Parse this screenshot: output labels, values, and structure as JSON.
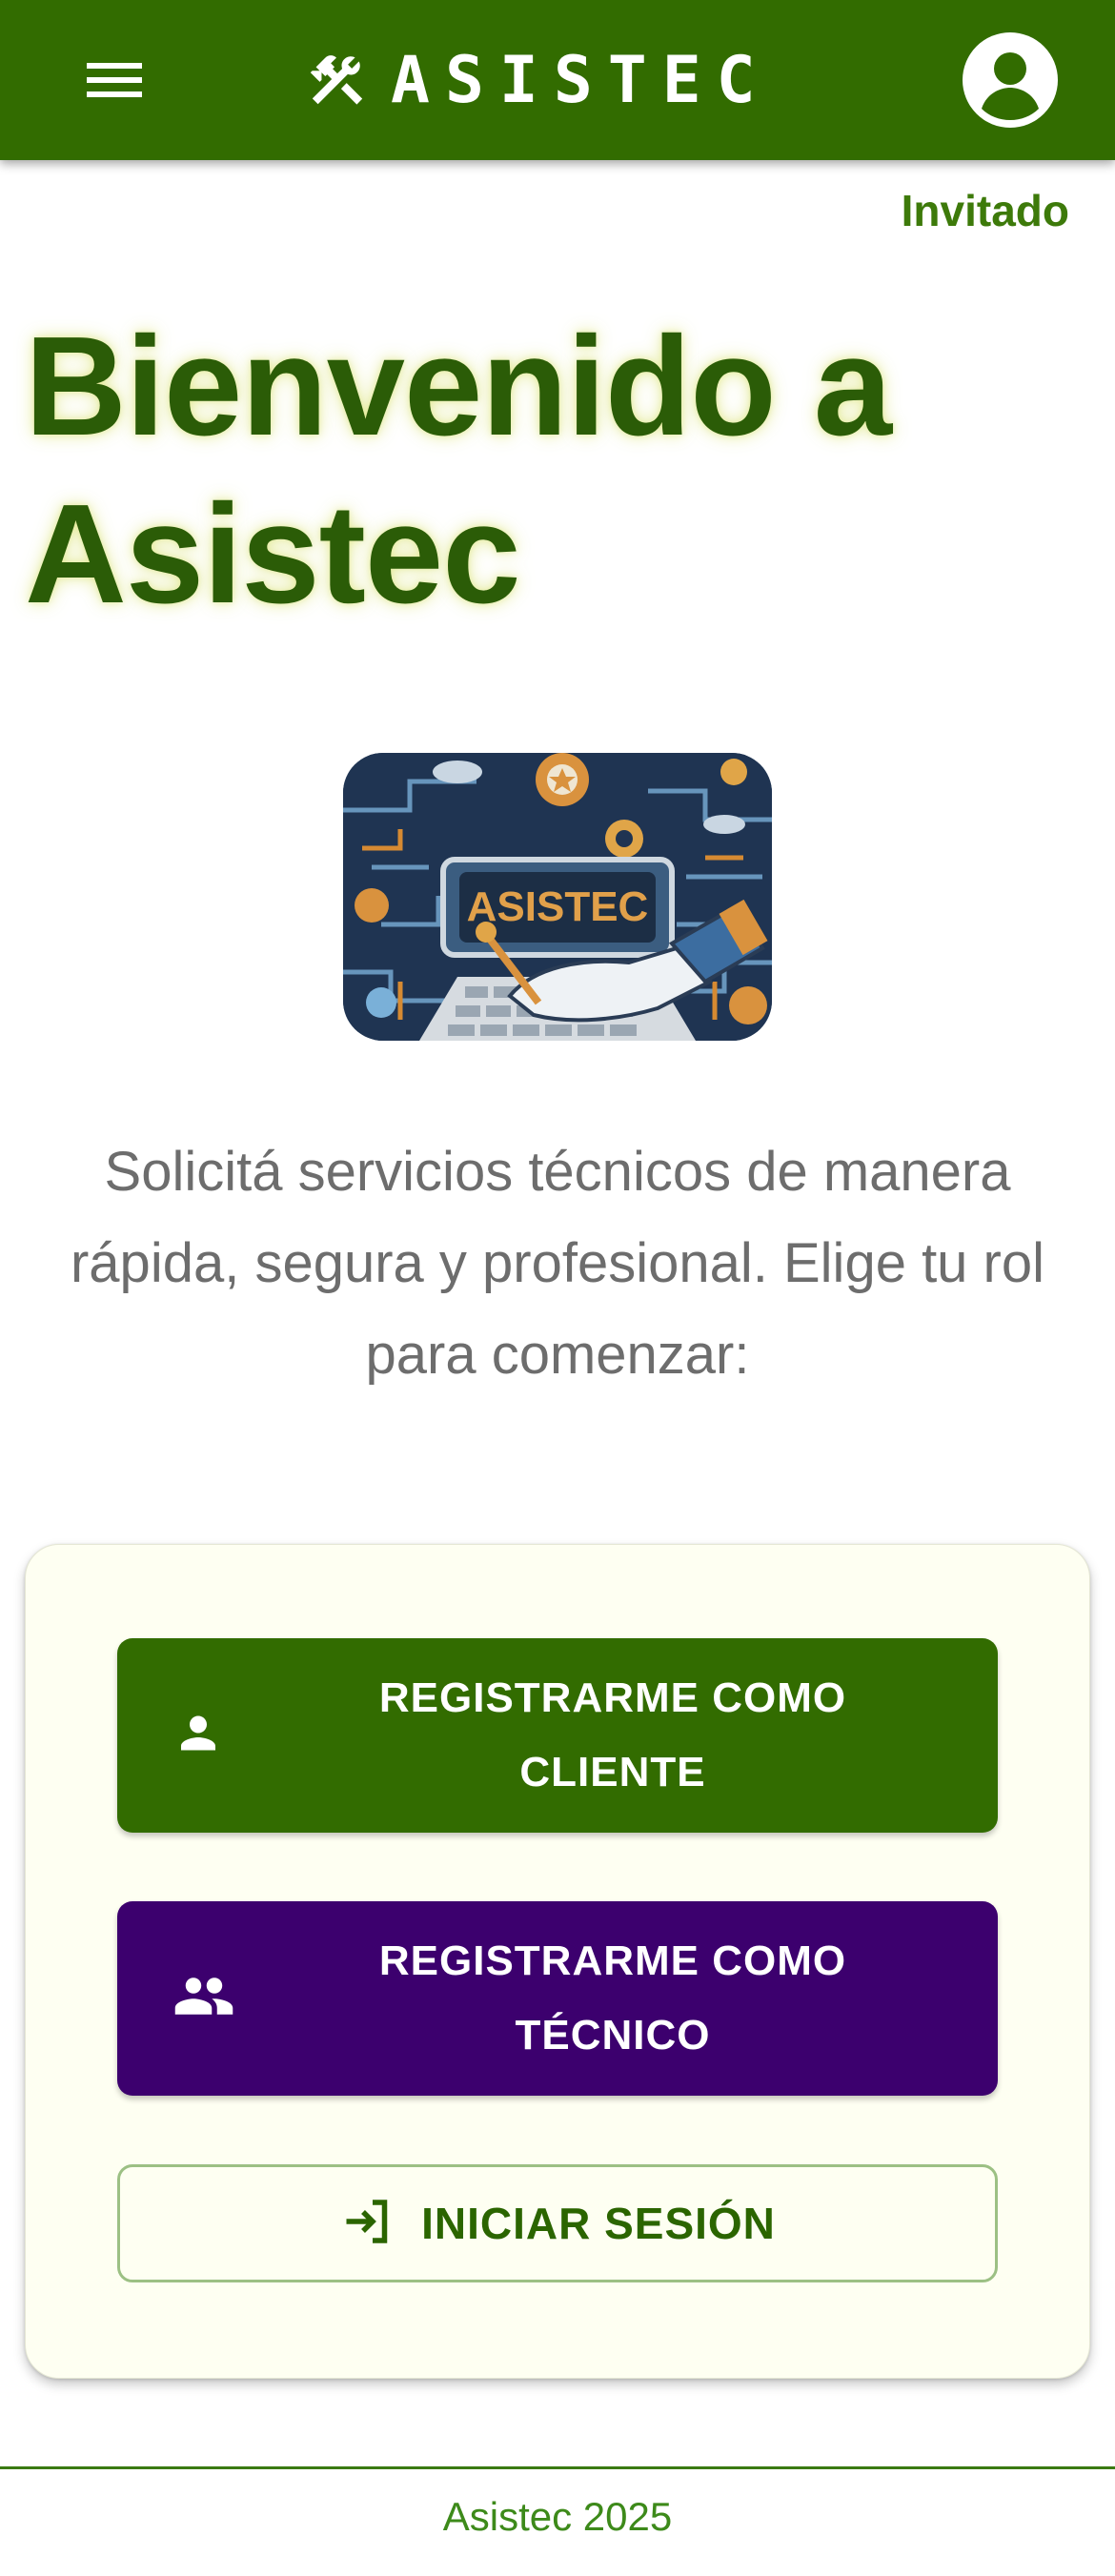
{
  "colors": {
    "appbar": "#326c00",
    "client_button": "#326c00",
    "tech_button": "#3c006e",
    "headline": "#2b5c07",
    "card_background": "#fefff2"
  },
  "header": {
    "brand": "ASISTEC",
    "menu_icon": "menu-icon",
    "brand_icon": "tools-icon",
    "account_icon": "account-circle-icon"
  },
  "user": {
    "label": "Invitado"
  },
  "hero": {
    "title_line1": "Bienvenido a",
    "title_line2": "Asistec",
    "logo_text": "ASISTEC",
    "intro": "Solicitá servicios técnicos de manera rápida, segura y profesional. Elige tu rol para comenzar:"
  },
  "actions": {
    "client_line1": "REGISTRARME COMO",
    "client_line2": "CLIENTE",
    "tech_line1": "REGISTRARME COMO",
    "tech_line2": "TÉCNICO",
    "login": "INICIAR SESIÓN",
    "client_icon": "person-icon",
    "tech_icon": "group-icon",
    "login_icon": "login-icon"
  },
  "footer": {
    "text": "Asistec 2025"
  }
}
